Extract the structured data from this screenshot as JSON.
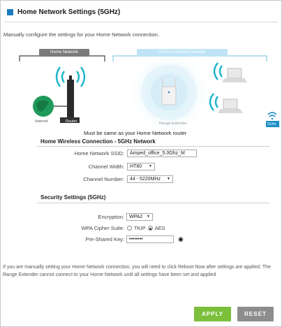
{
  "page": {
    "title": "Home Network Settings (5GHz)",
    "intro": "Manually configure the settings for your Home Network connection.",
    "accent_color": "#1b7dc1"
  },
  "diagram": {
    "home_network_label": "Home Network",
    "extended_network_label": "5GHz Extended Network",
    "internet_label": "Internet",
    "router_label": "Router",
    "range_extender_label": "Range Extender",
    "badge_label": "5GHz",
    "note": "Must be same as your Home Network router"
  },
  "wireless": {
    "heading": "Home Wireless Connection - 5GHz Network",
    "ssid_label": "Home Network SSID:",
    "ssid_value": "Amped_office_5.0Ghz_M",
    "width_label": "Channel Width:",
    "width_value": "HT80",
    "channel_label": "Channel Number:",
    "channel_value": "44 - 5220MHz"
  },
  "security": {
    "heading": "Security Settings (5GHz)",
    "encryption_label": "Encryption:",
    "encryption_value": "WPA2",
    "cipher_label": "WPA Cipher Suite:",
    "cipher_tkip": "TKIP",
    "cipher_aes": "AES",
    "cipher_selected": "AES",
    "psk_label": "Pre-Shared Key:",
    "psk_value": "••••••••"
  },
  "footer": {
    "note": "If you are manually setting your Home Network connection, you will need to click Reboot Now after settings are applied. The Range Extender cannot connect to your Home Network until all settings have been set and applied",
    "apply_label": "APPLY",
    "reset_label": "RESET",
    "apply_color": "#7bbf3a",
    "reset_color": "#8d8d8d"
  }
}
